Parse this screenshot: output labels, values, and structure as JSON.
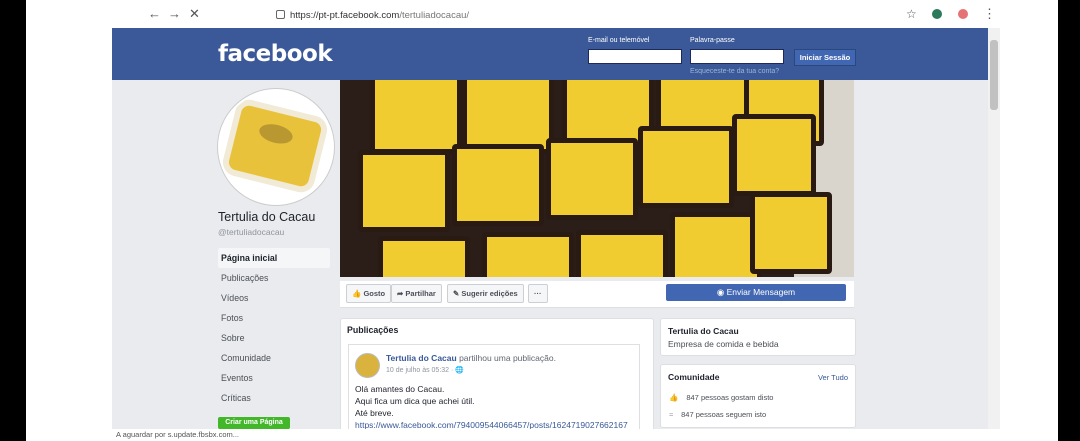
{
  "browser": {
    "url_main": "https://pt-pt.facebook.com",
    "url_path": "/tertuliadocacau/",
    "status": "A aguardar por s.update.fbsbx.com..."
  },
  "header": {
    "logo": "facebook",
    "email_label": "E-mail ou telemóvel",
    "password_label": "Palavra-passe",
    "login_button": "Iniciar Sessão",
    "forgot_link": "Esqueceste-te da tua conta?"
  },
  "profile": {
    "name": "Tertulia do Cacau",
    "handle": "@tertuliadocacau"
  },
  "nav": {
    "items": [
      {
        "label": "Página inicial"
      },
      {
        "label": "Publicações"
      },
      {
        "label": "Vídeos"
      },
      {
        "label": "Fotos"
      },
      {
        "label": "Sobre"
      },
      {
        "label": "Comunidade"
      },
      {
        "label": "Eventos"
      },
      {
        "label": "Críticas"
      }
    ],
    "create_page": "Criar uma Página"
  },
  "actions": {
    "like": "Gosto",
    "share": "Partilhar",
    "suggest": "Sugerir edições",
    "more": "···",
    "message": "Enviar Mensagem"
  },
  "posts": {
    "title": "Publicações",
    "author": "Tertulia do Cacau",
    "verb": "partilhou uma publicação.",
    "date": "10 de julho às 05:32 · ",
    "line1": "Olá amantes do Cacau.",
    "line2": "Aqui fica um dica que achei útil.",
    "line3": "Até breve.",
    "link": "https://www.facebook.com/794009544066457/posts/1624719027662167"
  },
  "about": {
    "name": "Tertulia do Cacau",
    "category": "Empresa de comida e bebida"
  },
  "community": {
    "title": "Comunidade",
    "see_all": "Ver Tudo",
    "likes": "847 pessoas gostam disto",
    "follows": "847 pessoas seguem isto"
  },
  "icons": [
    "back-icon",
    "forward-icon",
    "close-icon",
    "lock-icon",
    "star-icon",
    "extension-icon",
    "profile-icon",
    "menu-icon",
    "like-icon",
    "share-icon",
    "edit-icon",
    "messenger-icon",
    "globe-icon",
    "rss-icon"
  ]
}
